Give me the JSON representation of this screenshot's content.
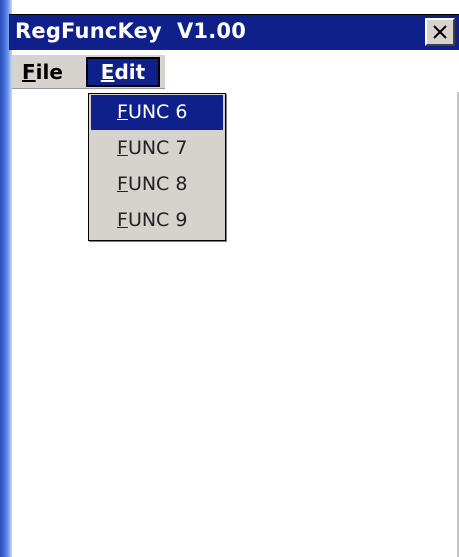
{
  "window": {
    "title": "RegFuncKey  V1.00",
    "close_icon": "close-icon"
  },
  "menubar": {
    "items": [
      {
        "mnemonic": "F",
        "rest": "ile"
      },
      {
        "mnemonic": "E",
        "rest": "dit",
        "open": true
      }
    ]
  },
  "dropdown": {
    "items": [
      {
        "mnemonic": "F",
        "rest": "UNC 6",
        "selected": true
      },
      {
        "mnemonic": "F",
        "rest": "UNC 7",
        "selected": false
      },
      {
        "mnemonic": "F",
        "rest": "UNC 8",
        "selected": false
      },
      {
        "mnemonic": "F",
        "rest": "UNC 9",
        "selected": false
      }
    ]
  },
  "colors": {
    "titlebar": "#10208a",
    "menu_bg": "#d6d3ce",
    "highlight": "#10208a",
    "frame_blue": "#3f6ad8"
  }
}
